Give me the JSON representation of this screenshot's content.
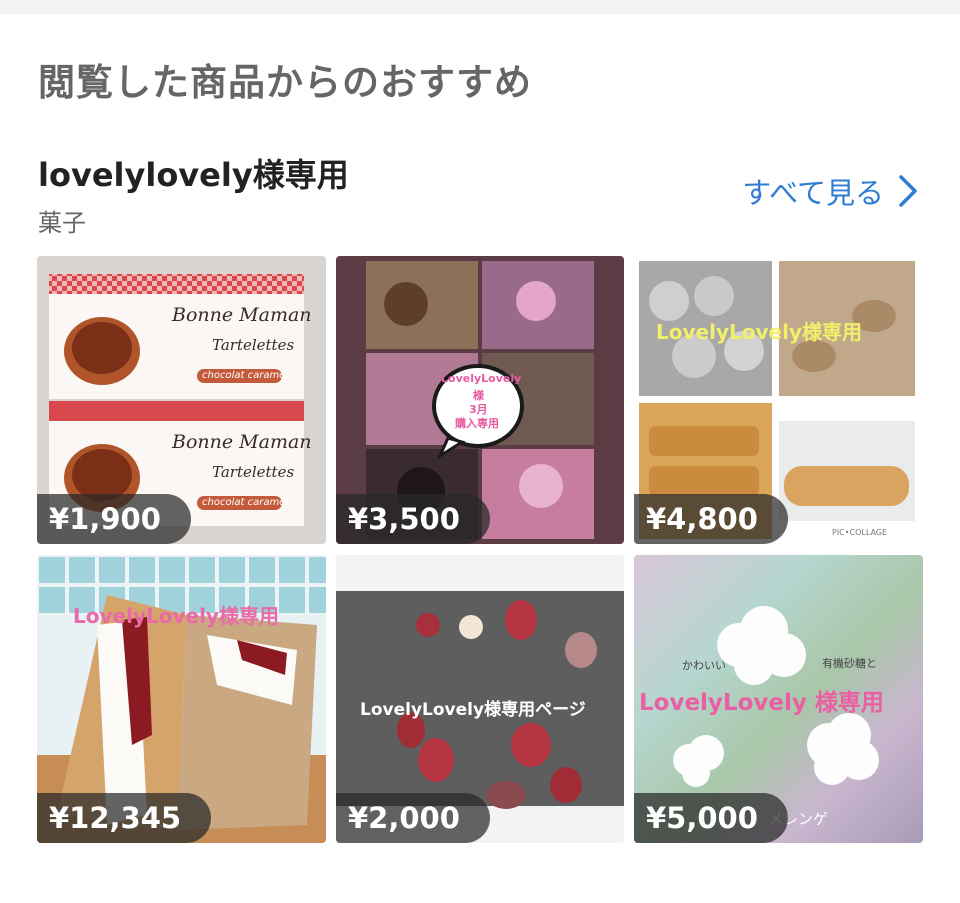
{
  "header": {
    "section_title": "閲覧した商品からのおすすめ",
    "shop_name": "lovelylovely様専用",
    "category": "菓子",
    "see_all_label": "すべて見る",
    "see_all_icon": "chevron-right-icon",
    "accent_color": "#2f7dd3"
  },
  "products": [
    {
      "price": "¥1,900",
      "image_text": [
        "Bonne Maman",
        "Tartelettes",
        "chocolat caramel",
        "Bonne Maman",
        "Tartelettes",
        "chocolat caramel"
      ]
    },
    {
      "price": "¥3,500",
      "image_text": [
        "LovelyLovely",
        "様",
        "3月",
        "購入専用"
      ]
    },
    {
      "price": "¥4,800",
      "image_text": [
        "LovelyLovely様専用",
        "PIC•COLLAGE"
      ]
    },
    {
      "price": "¥12,345",
      "image_text": [
        "LovelyLovely様専用"
      ]
    },
    {
      "price": "¥2,000",
      "image_text": [
        "LovelyLovely様専用ページ"
      ]
    },
    {
      "price": "¥5,000",
      "image_text": [
        "かわいい",
        "有機砂糖と",
        "LovelyLovely 様専用",
        "メレンゲ"
      ]
    }
  ]
}
